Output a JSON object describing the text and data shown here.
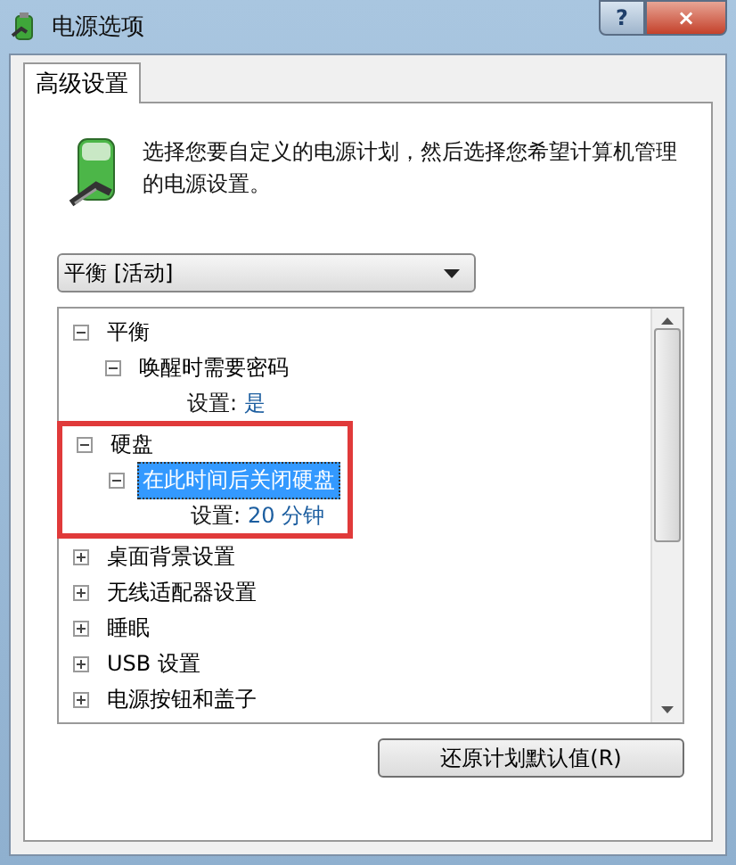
{
  "window": {
    "title": "电源选项",
    "help": "?",
    "close": "×"
  },
  "tabs": [
    {
      "label": "高级设置",
      "selected": true
    }
  ],
  "intro": "选择您要自定义的电源计划，然后选择您希望计算机管理的电源设置。",
  "plan_dropdown": {
    "value": "平衡 [活动]"
  },
  "settings_tree": [
    {
      "kind": "group",
      "label": "平衡",
      "expanded": true,
      "selected": false,
      "highlighted": false,
      "children": [
        {
          "kind": "group",
          "label": "唤醒时需要密码",
          "expanded": true,
          "selected": false,
          "highlighted": false,
          "children": [
            {
              "kind": "setting",
              "label": "设置:",
              "value": "是"
            }
          ]
        }
      ]
    },
    {
      "kind": "group",
      "label": "硬盘",
      "expanded": true,
      "selected": false,
      "highlighted": true,
      "children": [
        {
          "kind": "group",
          "label": "在此时间后关闭硬盘",
          "expanded": true,
          "selected": true,
          "highlighted": false,
          "children": [
            {
              "kind": "setting",
              "label": "设置:",
              "value": "20 分钟"
            }
          ]
        }
      ]
    },
    {
      "kind": "group",
      "label": "桌面背景设置",
      "expanded": false,
      "selected": false,
      "highlighted": false
    },
    {
      "kind": "group",
      "label": "无线适配器设置",
      "expanded": false,
      "selected": false,
      "highlighted": false
    },
    {
      "kind": "group",
      "label": "睡眠",
      "expanded": false,
      "selected": false,
      "highlighted": false
    },
    {
      "kind": "group",
      "label": "USB 设置",
      "expanded": false,
      "selected": false,
      "highlighted": false
    },
    {
      "kind": "group",
      "label": "电源按钮和盖子",
      "expanded": false,
      "selected": false,
      "highlighted": false
    }
  ],
  "restore_button": "还原计划默认值(R)"
}
